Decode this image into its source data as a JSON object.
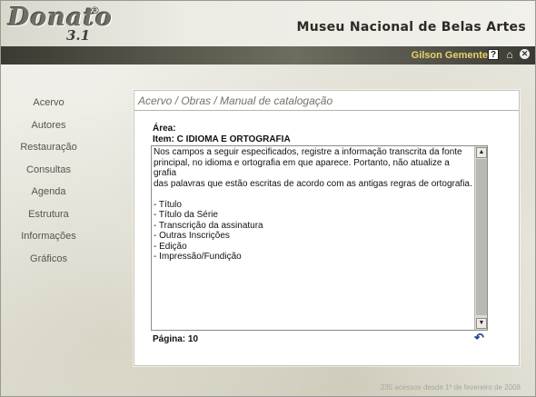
{
  "app": {
    "logo_word": "Donato",
    "logo_version": "3.1",
    "logo_reg": "®",
    "museum_title": "Museu Nacional de Belas Artes"
  },
  "userbar": {
    "user_name": "Gilson Gemente",
    "help_icon": "?",
    "home_icon": "⌂",
    "close_icon": "✕"
  },
  "sidebar": {
    "items": [
      {
        "label": "Acervo"
      },
      {
        "label": "Autores"
      },
      {
        "label": "Restauração"
      },
      {
        "label": "Consultas"
      },
      {
        "label": "Agenda"
      },
      {
        "label": "Estrutura"
      },
      {
        "label": "Informações"
      },
      {
        "label": "Gráficos"
      }
    ]
  },
  "main": {
    "breadcrumb": "Acervo / Obras / Manual de catalogação",
    "area_label": "Área:",
    "item_label": "Item: C   IDIOMA E ORTOGRAFIA",
    "text_lines": [
      "Nos campos a seguir especificados, registre a informação transcrita da fonte",
      "principal, no idioma e ortografia em que aparece. Portanto, não atualize a grafia",
      "das palavras que estão escritas de acordo com as antigas regras de ortografia.",
      "",
      "- Título",
      "- Título da Série",
      "- Transcrição da assinatura",
      "- Outras Inscrições",
      "- Edição",
      "- Impressão/Fundição"
    ],
    "page_label": "Página: 10",
    "scroll_up": "▲",
    "scroll_down": "▼",
    "back_icon": "↶"
  },
  "footer": {
    "text": "235 acessos desde 1º de fevereiro de 2008"
  },
  "colors": {
    "user_name": "#e8d36a",
    "back_icon": "#1f3d9a"
  }
}
